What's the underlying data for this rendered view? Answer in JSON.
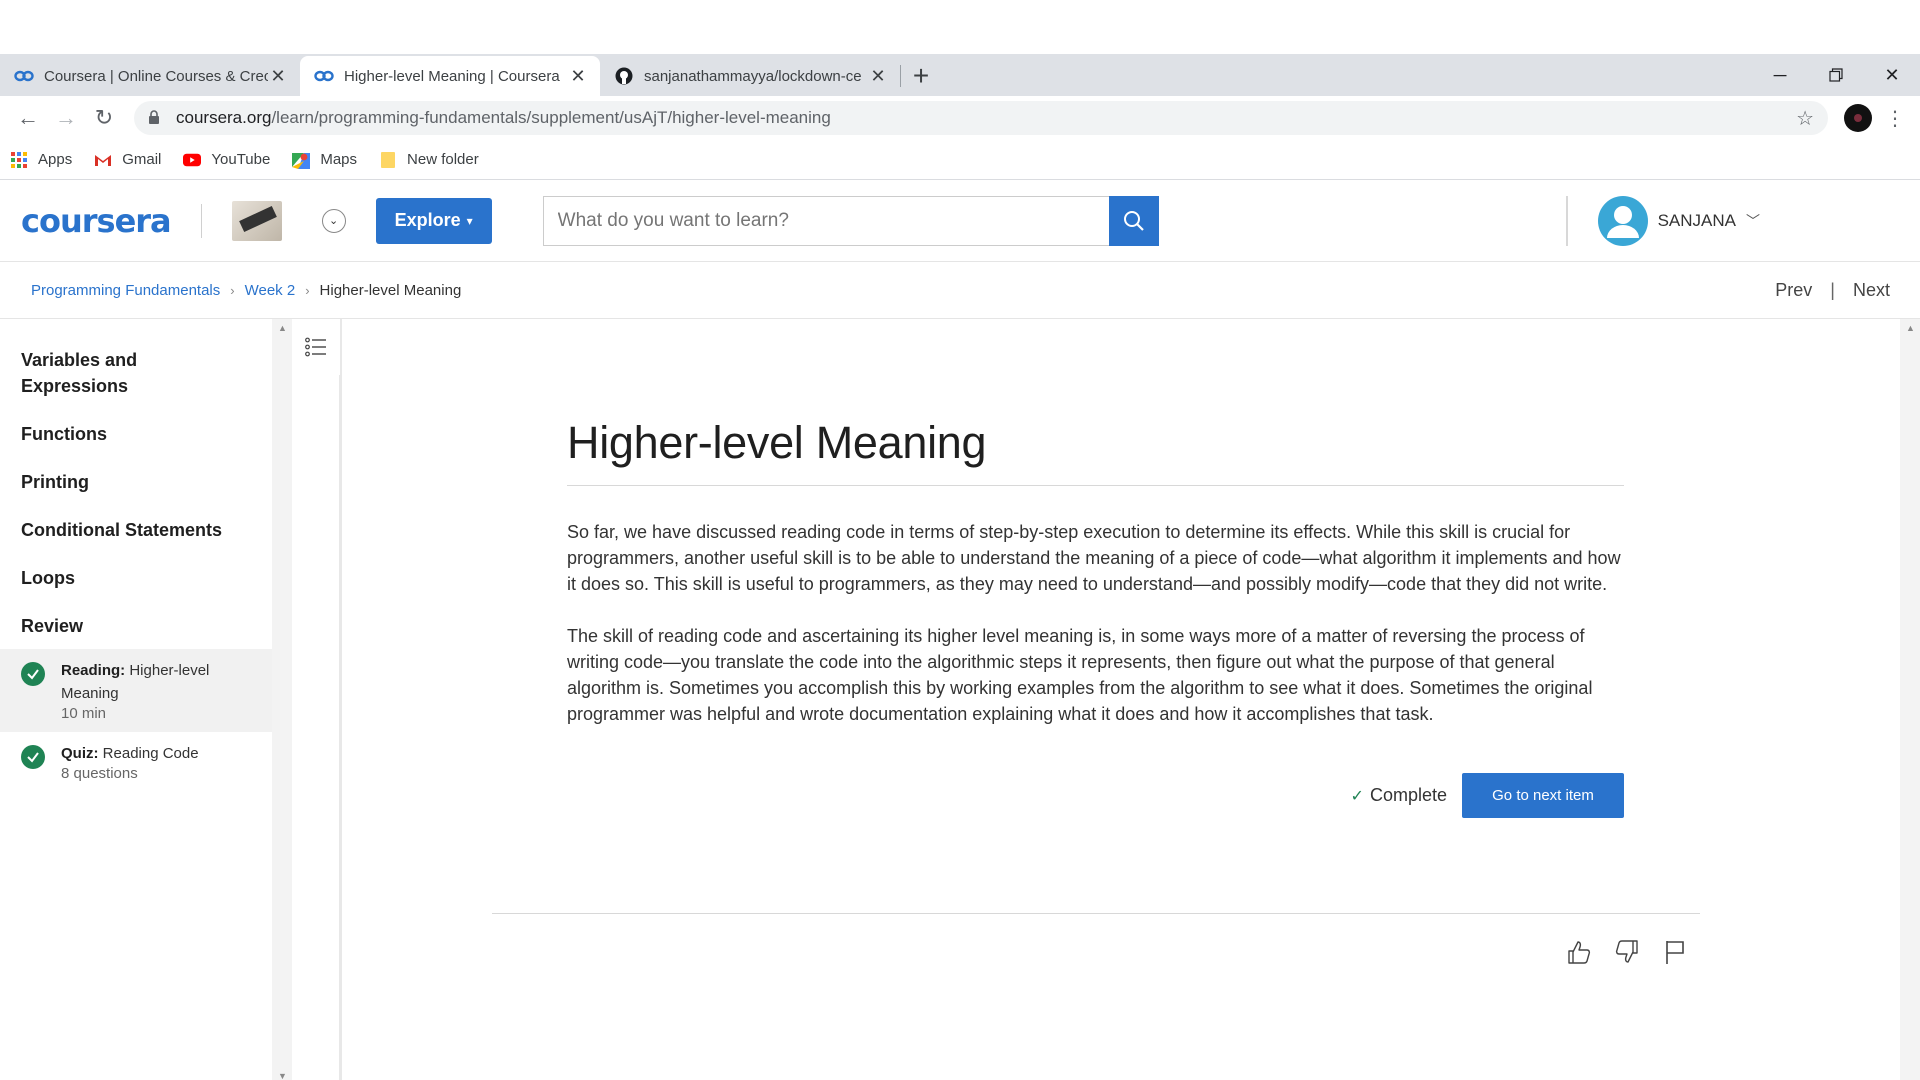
{
  "browser": {
    "tabs": [
      {
        "title": "Coursera | Online Courses & Crec",
        "active": false
      },
      {
        "title": "Higher-level Meaning | Coursera",
        "active": true
      },
      {
        "title": "sanjanathammayya/lockdown-ce",
        "active": false
      }
    ],
    "new_tab": "+",
    "url_host": "coursera.org",
    "url_path": "/learn/programming-fundamentals/supplement/usAjT/higher-level-meaning",
    "bookmarks": [
      "Apps",
      "Gmail",
      "YouTube",
      "Maps",
      "New folder"
    ]
  },
  "header": {
    "logo": "coursera",
    "explore_label": "Explore",
    "search_placeholder": "What do you want to learn?",
    "username": "SANJANA"
  },
  "breadcrumb": {
    "course": "Programming Fundamentals",
    "week": "Week 2",
    "current": "Higher-level Meaning",
    "prev": "Prev",
    "next": "Next",
    "sep": "|"
  },
  "sidebar": {
    "modules": [
      "Variables and Expressions",
      "Functions",
      "Printing",
      "Conditional Statements",
      "Loops",
      "Review"
    ],
    "items": [
      {
        "type": "Reading:",
        "title": "Higher-level Meaning",
        "meta": "10 min",
        "active": true,
        "completed": true
      },
      {
        "type": "Quiz:",
        "title": "Reading Code",
        "meta": "8 questions",
        "active": false,
        "completed": true
      }
    ]
  },
  "article": {
    "title": "Higher-level Meaning",
    "paragraphs": [
      "So far, we have discussed reading code in terms of step-by-step execution to determine its effects. While this skill is crucial for programmers, another useful skill is to be able to understand the meaning of a piece of code—what algorithm it implements and how it does so. This skill is useful to programmers, as they may need to understand—and possibly modify—code that they did not write.",
      "The skill of reading code and ascertaining its higher level meaning is, in some ways more of a matter of reversing the process of writing code—you translate the code into the algorithmic steps it represents, then figure out what the purpose of that general algorithm is. Sometimes you accomplish this by working examples from the algorithm to see what it does. Sometimes the original programmer was helpful and wrote documentation explaining what it does and how it accomplishes that task."
    ],
    "complete_label": "Complete",
    "next_item_label": "Go to next item"
  },
  "colors": {
    "brand_blue": "#2a73cc",
    "complete_green": "#1f8354"
  }
}
